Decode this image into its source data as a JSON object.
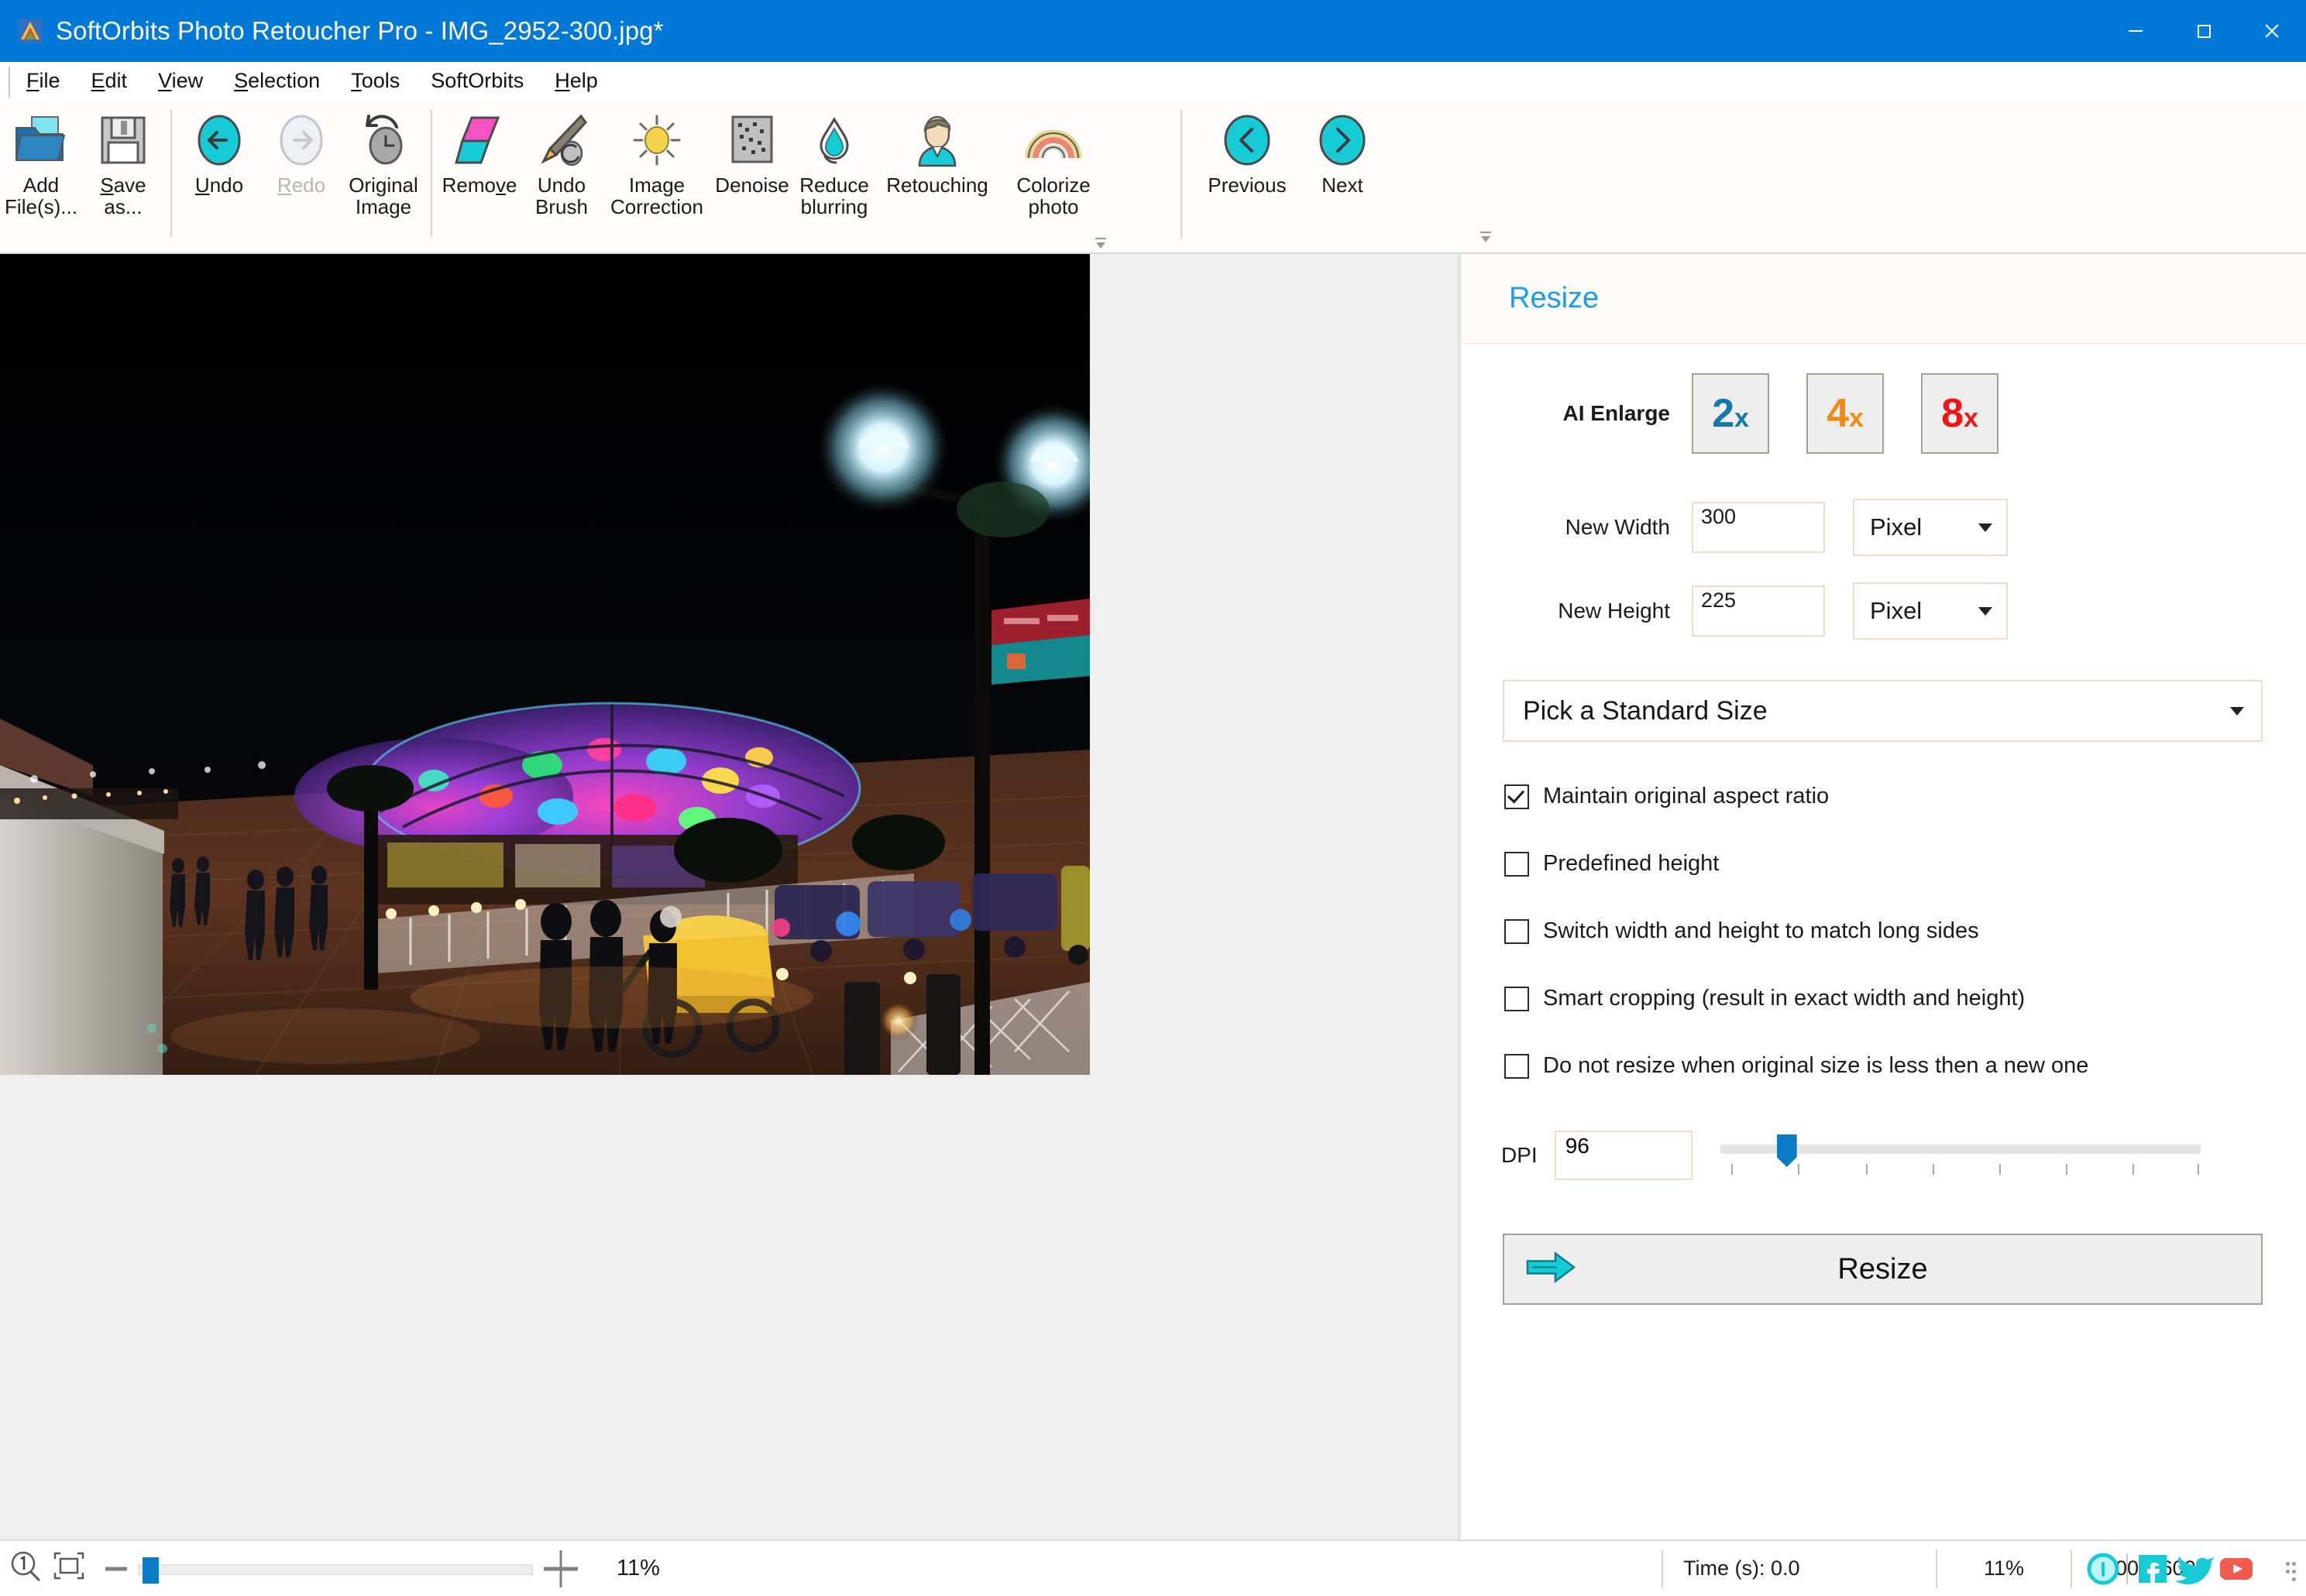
{
  "window": {
    "title": "SoftOrbits Photo Retoucher Pro - IMG_2952-300.jpg*",
    "app_icon": "softorbits-logo-icon",
    "controls": {
      "minimize": "minimize-icon",
      "maximize": "maximize-icon",
      "close": "close-icon"
    },
    "titlebar_color": "#0078D7"
  },
  "menubar": {
    "items": [
      {
        "label": "File",
        "accel": "F"
      },
      {
        "label": "Edit",
        "accel": "E"
      },
      {
        "label": "View",
        "accel": "V"
      },
      {
        "label": "Selection",
        "accel": "S"
      },
      {
        "label": "Tools",
        "accel": "T"
      },
      {
        "label": "SoftOrbits",
        "accel": ""
      },
      {
        "label": "Help",
        "accel": "H"
      }
    ]
  },
  "toolbar": {
    "groups": [
      {
        "tools": [
          {
            "label": "Add\nFile(s)...",
            "icon": "open-folder-icon",
            "disabled": false
          },
          {
            "label": "Save\nas...",
            "icon": "floppy-disk-icon",
            "disabled": false
          }
        ]
      },
      {
        "tools": [
          {
            "label": "Undo",
            "icon": "undo-arrow-left-icon",
            "disabled": false
          },
          {
            "label": "Redo",
            "icon": "redo-arrow-right-icon",
            "disabled": true
          },
          {
            "label": "Original\nImage",
            "icon": "clock-revert-icon",
            "disabled": false
          }
        ]
      },
      {
        "tools": [
          {
            "label": "Remove",
            "icon": "eraser-icon",
            "disabled": false
          },
          {
            "label": "Undo\nBrush",
            "icon": "brush-icon",
            "disabled": false
          },
          {
            "label": "Image\nCorrection",
            "icon": "sun-brightness-icon",
            "disabled": false
          },
          {
            "label": "Denoise",
            "icon": "noise-grid-icon",
            "disabled": false
          },
          {
            "label": "Reduce\nblurring",
            "icon": "water-drop-icon",
            "disabled": false
          },
          {
            "label": "Retouching",
            "icon": "person-portrait-icon",
            "disabled": false
          },
          {
            "label": "Colorize\nphoto",
            "icon": "rainbow-icon",
            "disabled": false
          }
        ]
      },
      {
        "tools": [
          {
            "label": "Previous",
            "icon": "chevron-left-circle-icon",
            "disabled": false
          },
          {
            "label": "Next",
            "icon": "chevron-right-circle-icon",
            "disabled": false
          }
        ]
      }
    ],
    "overflow_icon": "overflow-chevron-down-icon"
  },
  "canvas": {
    "photo_alt": "night boardwalk with illuminated colorful canopy, street lamps and people",
    "background_color": "#EFEFEF"
  },
  "panel": {
    "title": "Resize",
    "title_color": "#189CEB",
    "ai_enlarge": {
      "label": "AI Enlarge",
      "options": [
        {
          "num": "2",
          "suffix": "x",
          "color": "#1478AA"
        },
        {
          "num": "4",
          "suffix": "x",
          "color": "#F08C10"
        },
        {
          "num": "8",
          "suffix": "x",
          "color": "#F01515"
        }
      ]
    },
    "fields": [
      {
        "label": "New Width",
        "value": "300",
        "unit": "Pixel"
      },
      {
        "label": "New Height",
        "value": "225",
        "unit": "Pixel"
      }
    ],
    "standard_size": {
      "label": "Pick a Standard Size",
      "icon": "chevron-down-icon"
    },
    "checkboxes": [
      {
        "label": "Maintain original aspect ratio",
        "checked": true
      },
      {
        "label": "Predefined height",
        "checked": false
      },
      {
        "label": "Switch width and height to match long sides",
        "checked": false
      },
      {
        "label": "Smart cropping (result in exact width and height)",
        "checked": false
      },
      {
        "label": "Do not resize when original size is less then a new one",
        "checked": false
      }
    ],
    "dpi": {
      "label": "DPI",
      "value": "96",
      "slider_position_pct": 12
    },
    "resize_button": {
      "label": "Resize",
      "icon": "double-arrow-right-icon"
    }
  },
  "statusbar": {
    "zoom_icon": "magnifier-one-to-one-icon",
    "fit_icon": "fit-to-screen-icon",
    "minus_icon": "zoom-out-icon",
    "plus_icon": "zoom-in-icon",
    "zoom_percent": "11%",
    "zoom_slider_pct": 2,
    "time_label": "Time (s): 0.0",
    "zoom_percent_right": "11%",
    "image_dimensions": "4800x3600",
    "social": [
      {
        "name": "info-icon",
        "color": "#1FD0D6"
      },
      {
        "name": "facebook-icon",
        "color": "#1FD0D6"
      },
      {
        "name": "twitter-icon",
        "color": "#1FD0D6"
      },
      {
        "name": "youtube-icon",
        "color": "#F05A51"
      }
    ],
    "grip_icon": "resize-grip-icon"
  }
}
